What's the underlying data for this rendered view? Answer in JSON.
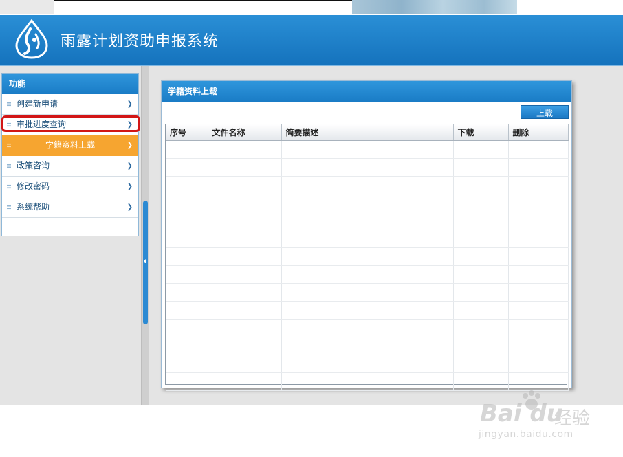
{
  "app": {
    "title": "雨露计划资助申报系统"
  },
  "sidebar": {
    "heading": "功能",
    "items": [
      {
        "label": "创建新申请"
      },
      {
        "label": "审批进度查询"
      },
      {
        "label": "学籍资料上载",
        "active": true
      },
      {
        "label": "政策咨询"
      },
      {
        "label": "修改密码"
      },
      {
        "label": "系统帮助"
      }
    ]
  },
  "panel": {
    "title": "学籍资料上载",
    "upload_label": "上载",
    "columns": [
      "序号",
      "文件名称",
      "简要描述",
      "下载",
      "删除"
    ],
    "rows": []
  },
  "watermark": {
    "logo": "Bai du",
    "cn": "经验",
    "url": "jingyan.baidu.com"
  },
  "colors": {
    "header_blue": "#1a7cc6",
    "active_orange": "#f6a530",
    "highlight_red": "#d21616"
  }
}
